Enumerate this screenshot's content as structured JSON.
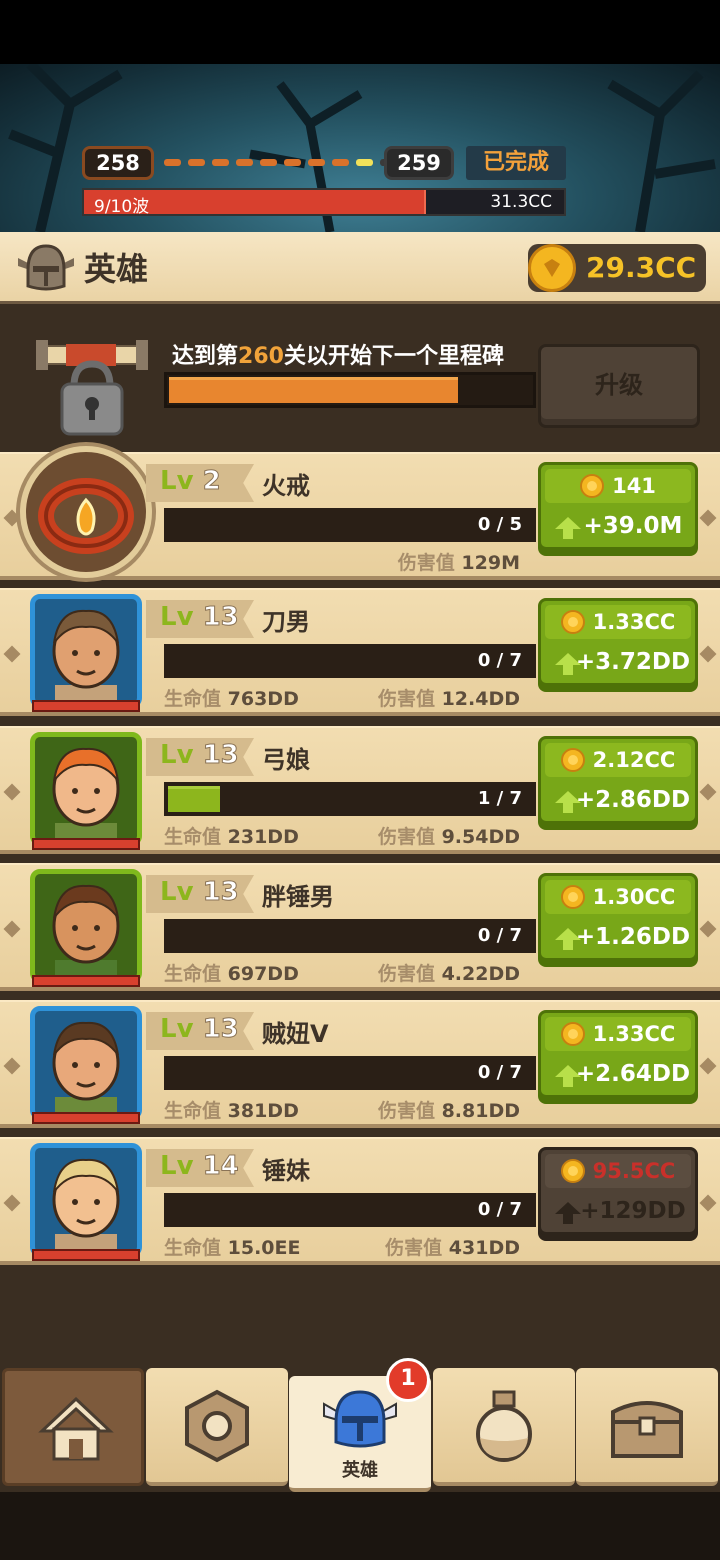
{
  "stage": {
    "current": "258",
    "next": "259",
    "status": "已完成",
    "wave": "9/10波",
    "wave_progress": 0.9,
    "reward": "31.3CC"
  },
  "header": {
    "title": "英雄",
    "gold": "29.3CC"
  },
  "milestone": {
    "text_pre": "达到第",
    "level": "260",
    "text_post": "关以开始下一个里程碑",
    "progress": 0.78,
    "button": "升级"
  },
  "heroes": [
    {
      "lv_prefix": "Lv",
      "lv": "2",
      "name": "火戒",
      "progress_text": "0 / 5",
      "progress": 0,
      "stat1_label": "",
      "stat1_value": "",
      "stat2_label": "伤害值",
      "stat2_value": "129M",
      "cost": "141",
      "gain": "+39.0M",
      "affordable": true
    },
    {
      "lv_prefix": "Lv",
      "lv": "13",
      "name": "刀男",
      "progress_text": "0 / 7",
      "progress": 0,
      "stat1_label": "生命值",
      "stat1_value": "763DD",
      "stat2_label": "伤害值",
      "stat2_value": "12.4DD",
      "cost": "1.33CC",
      "gain": "+3.72DD",
      "affordable": true
    },
    {
      "lv_prefix": "Lv",
      "lv": "13",
      "name": "弓娘",
      "progress_text": "1 / 7",
      "progress": 0.143,
      "stat1_label": "生命值",
      "stat1_value": "231DD",
      "stat2_label": "伤害值",
      "stat2_value": "9.54DD",
      "cost": "2.12CC",
      "gain": "+2.86DD",
      "affordable": true
    },
    {
      "lv_prefix": "Lv",
      "lv": "13",
      "name": "胖锤男",
      "progress_text": "0 / 7",
      "progress": 0,
      "stat1_label": "生命值",
      "stat1_value": "697DD",
      "stat2_label": "伤害值",
      "stat2_value": "4.22DD",
      "cost": "1.30CC",
      "gain": "+1.26DD",
      "affordable": true
    },
    {
      "lv_prefix": "Lv",
      "lv": "13",
      "name": "贼妞V",
      "progress_text": "0 / 7",
      "progress": 0,
      "stat1_label": "生命值",
      "stat1_value": "381DD",
      "stat2_label": "伤害值",
      "stat2_value": "8.81DD",
      "cost": "1.33CC",
      "gain": "+2.64DD",
      "affordable": true
    },
    {
      "lv_prefix": "Lv",
      "lv": "14",
      "name": "锤妹",
      "progress_text": "0 / 7",
      "progress": 0,
      "stat1_label": "生命值",
      "stat1_value": "15.0EE",
      "stat2_label": "伤害值",
      "stat2_value": "431DD",
      "cost": "95.5CC",
      "gain": "+129DD",
      "affordable": false
    }
  ],
  "nav": {
    "tabs": [
      {
        "icon": "home-icon"
      },
      {
        "icon": "settings-nut-icon"
      },
      {
        "icon": "helmet-icon",
        "label": "英雄"
      },
      {
        "icon": "potion-icon"
      },
      {
        "icon": "chest-icon"
      }
    ],
    "badge": "1"
  },
  "colors": {
    "accent_green": "#78a718",
    "gold": "#f4b620",
    "wave_red": "#d8402e",
    "progress_orange": "#e8862f"
  }
}
